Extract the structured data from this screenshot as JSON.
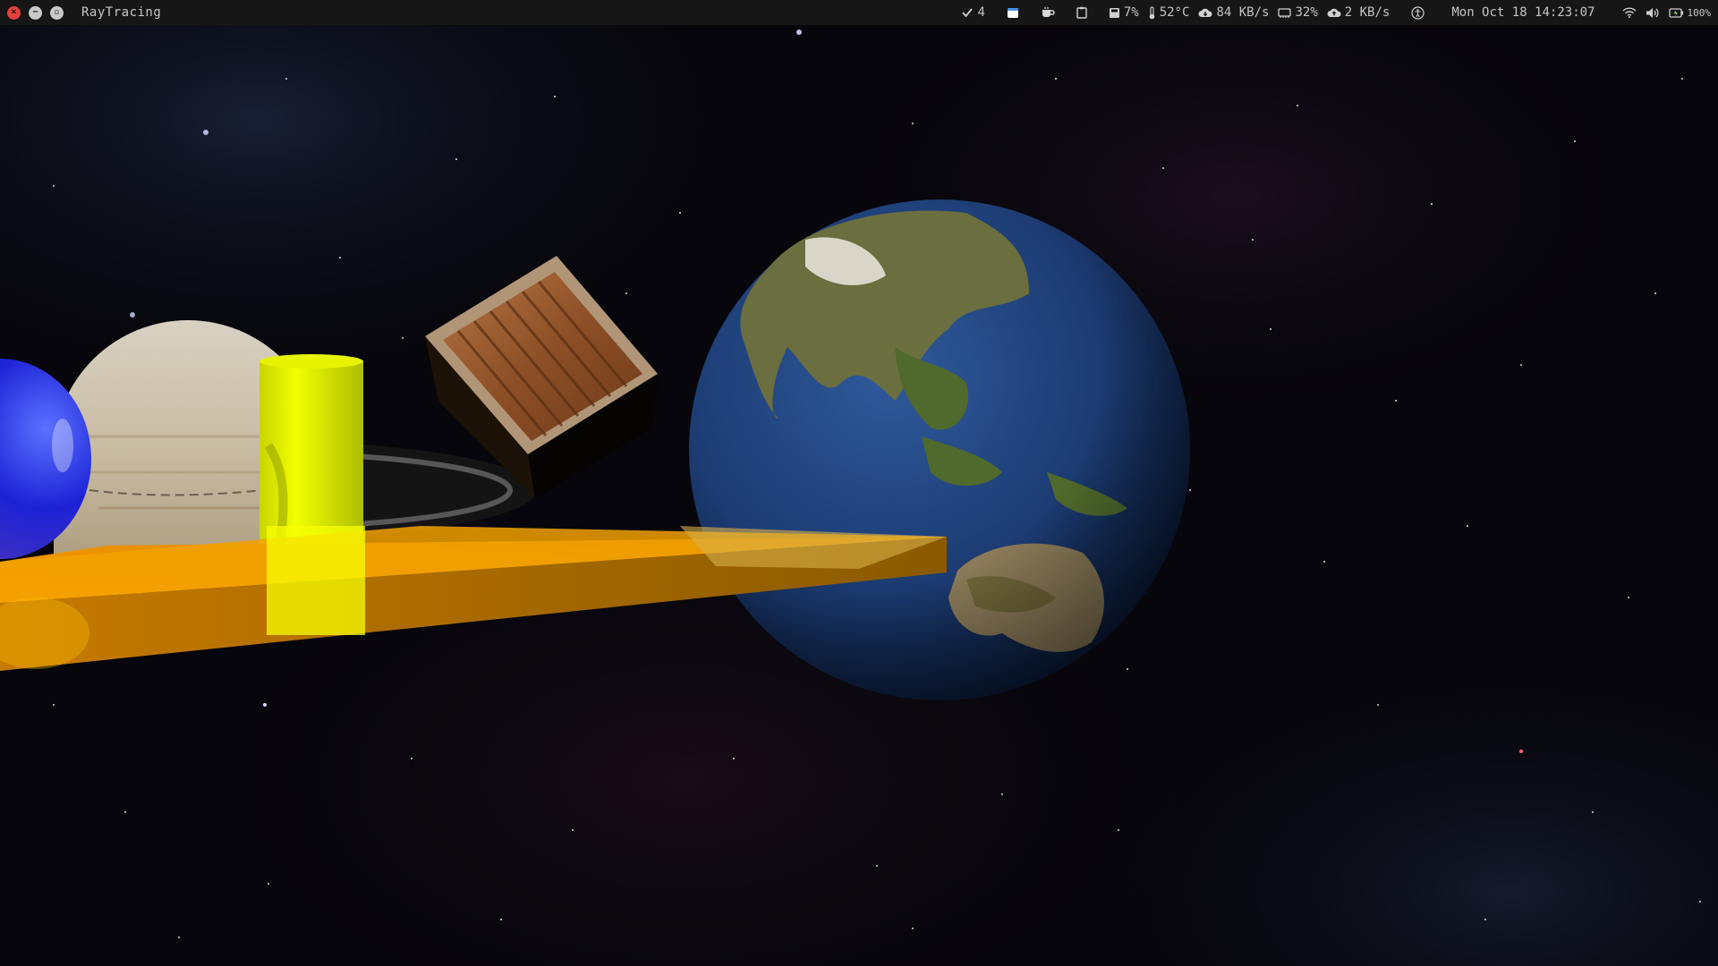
{
  "window": {
    "title": "RayTracing"
  },
  "tray": {
    "updates_count": "4",
    "disk_usage": "7%",
    "temperature": "52°C",
    "download_speed": "84 KB/s",
    "memory_usage": "32%",
    "upload_speed": "2 KB/s",
    "datetime": "Mon Oct 18 14:23:07",
    "battery": "100%"
  },
  "icons": {
    "close": "close-icon",
    "minimize": "minimize-icon",
    "maximize": "maximize-icon",
    "updates": "checkmark-icon",
    "calendar": "calendar-icon",
    "coffee": "coffee-icon",
    "clipboard": "clipboard-icon",
    "disk": "disk-icon",
    "thermometer": "thermometer-icon",
    "download": "cloud-download-icon",
    "memory": "memory-icon",
    "upload": "cloud-upload-icon",
    "accessibility": "accessibility-icon",
    "wifi": "wifi-icon",
    "volume": "volume-icon",
    "battery": "battery-icon"
  },
  "colors": {
    "topbar_bg": "#161616",
    "close_red": "#e2403c",
    "accent_blue": "#4a8fe8"
  },
  "scene": {
    "objects": [
      "blue-sphere",
      "saturn-planet",
      "yellow-cylinder",
      "wooden-crate",
      "earth-globe",
      "orange-slab"
    ]
  }
}
